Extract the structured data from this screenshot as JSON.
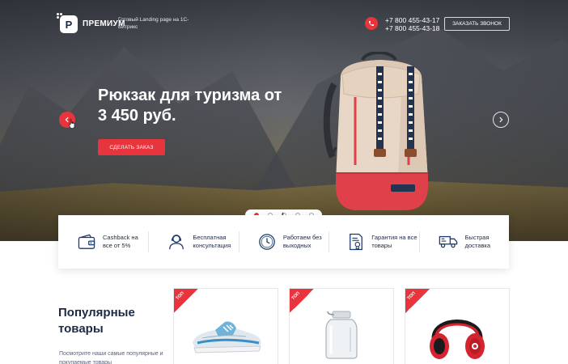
{
  "colors": {
    "accent": "#e8343c",
    "dark": "#1b2a44",
    "text_muted": "#596377"
  },
  "header": {
    "logo_text": "ПРЕМИУМ",
    "tagline": "Готовый Landing page на 1С-Битрикс",
    "phones": [
      "+7 800 455-43-17",
      "+7 800 455-43-18"
    ],
    "callback_label": "ЗАКАЗАТЬ ЗВОНОК"
  },
  "hero": {
    "title": "Рюкзак для туризма от 3 450 руб.",
    "button_label": "СДЕЛАТЬ ЗАКАЗ",
    "slides": 5,
    "active_slide": 1
  },
  "features": [
    {
      "icon": "wallet-icon",
      "label": "Cashback на все от 5%"
    },
    {
      "icon": "support-agent-icon",
      "label": "Бесплатная консультация"
    },
    {
      "icon": "clock-icon",
      "label": "Работаем без выходных"
    },
    {
      "icon": "certificate-icon",
      "label": "Гарантия на все товары"
    },
    {
      "icon": "delivery-truck-icon",
      "label": "Быстрая доставка"
    }
  ],
  "popular": {
    "title_line1": "Популярные",
    "title_line2": "товары",
    "description": "Посмотрите наши самые популярные и покупаемые товары"
  },
  "products": [
    {
      "badge": "ТОП",
      "image": "sneakers"
    },
    {
      "badge": "ТОП",
      "image": "glass-jar"
    },
    {
      "badge": "ТОП",
      "image": "headphones"
    }
  ]
}
